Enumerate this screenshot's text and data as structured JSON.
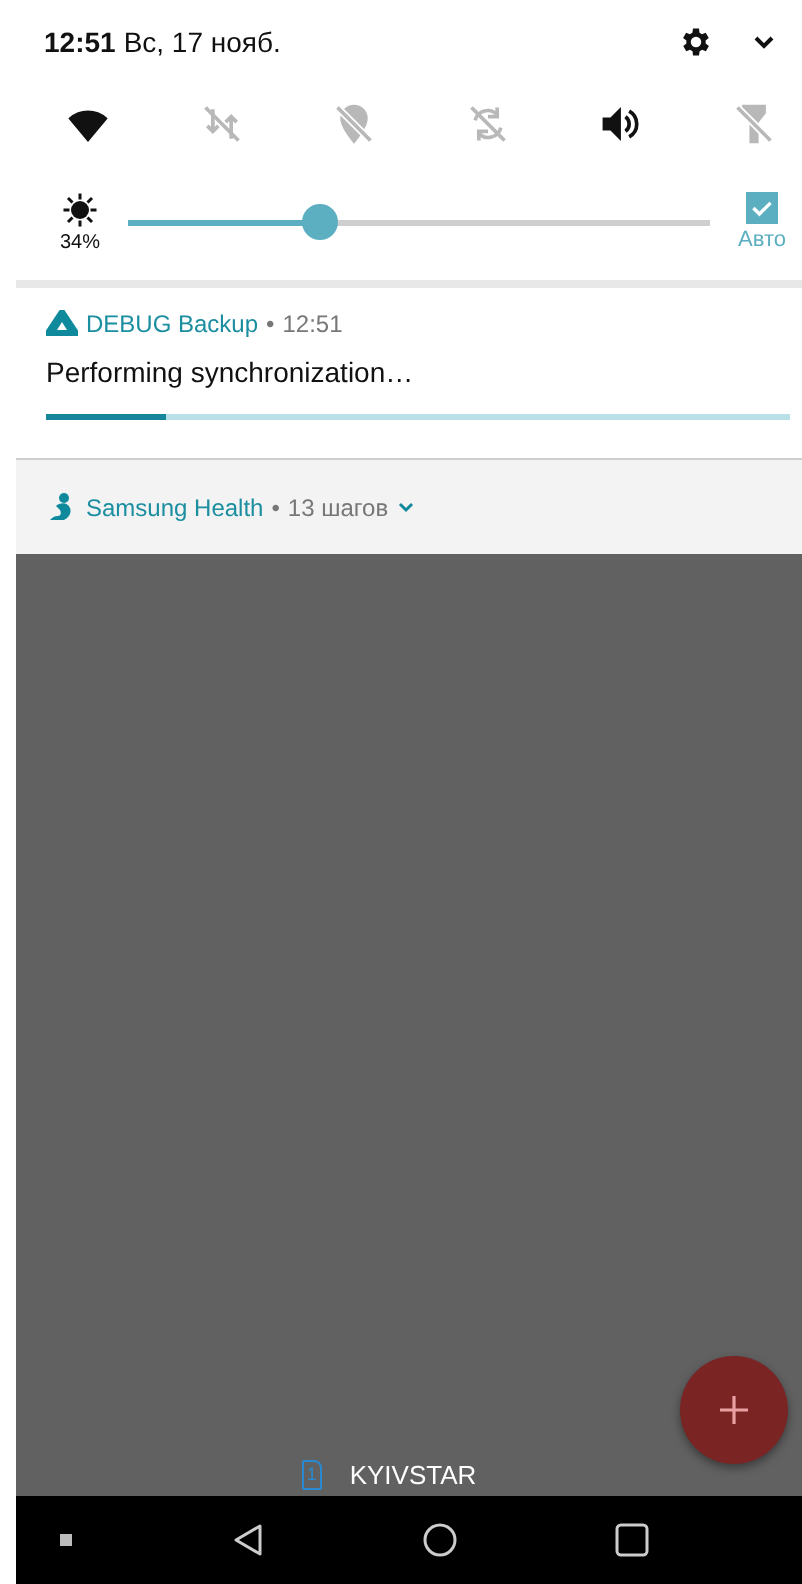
{
  "status": {
    "time": "12:51",
    "date": "Вс, 17 нояб."
  },
  "tiles": [
    {
      "kind": "wifi",
      "on": true
    },
    {
      "kind": "data",
      "on": false
    },
    {
      "kind": "location",
      "on": false
    },
    {
      "kind": "sync",
      "on": false
    },
    {
      "kind": "sound",
      "on": true
    },
    {
      "kind": "flashlight",
      "on": false
    }
  ],
  "brightness": {
    "reading": "34%",
    "level": 0.34,
    "auto": {
      "label": "Авто",
      "checked": true
    }
  },
  "notifications": [
    {
      "kind": "progress",
      "app": "DEBUG Backup",
      "separator": "•",
      "time": "12:51",
      "text": "Performing synchronization…",
      "level": 0.16
    },
    {
      "kind": "summary",
      "app": "Samsung Health",
      "separator": "•",
      "info": "13 шагов"
    }
  ],
  "carrier": {
    "sim_slot": "1",
    "name": "KYIVSTAR"
  }
}
